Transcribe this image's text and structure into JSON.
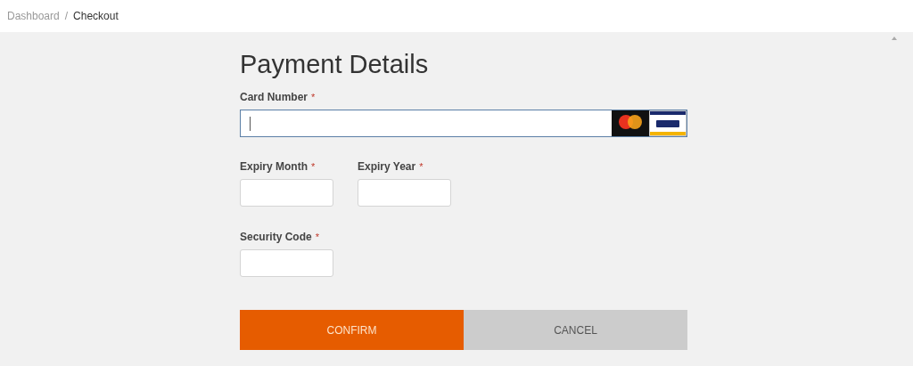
{
  "breadcrumb": [
    {
      "label": "Dashboard",
      "current": false
    },
    {
      "label": "/",
      "current": false
    },
    {
      "label": "Checkout",
      "current": true
    }
  ],
  "title": "Payment Details",
  "card_number": {
    "label": "Card Number",
    "required_mark": "*",
    "focused": true
  },
  "expiry_month": {
    "label": "Expiry Month",
    "required_mark": "*",
    "focused": false
  },
  "expiry_year": {
    "label": "Expiry Year",
    "required_mark": "*",
    "focused": false
  },
  "security_code": {
    "label": "Security Code",
    "required_mark": "*",
    "focused": false
  },
  "buttons": [
    {
      "label": "CONFIRM",
      "kind": "primary"
    },
    {
      "label": "CANCEL",
      "kind": "secondary"
    }
  ]
}
